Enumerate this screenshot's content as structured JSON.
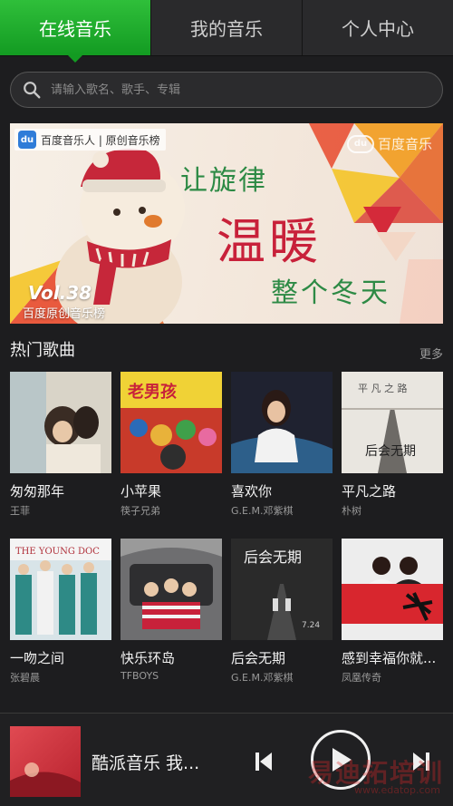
{
  "tabs": [
    {
      "label": "在线音乐",
      "active": true
    },
    {
      "label": "我的音乐",
      "active": false
    },
    {
      "label": "个人中心",
      "active": false
    }
  ],
  "search": {
    "placeholder": "请输入歌名、歌手、专辑",
    "icon": "search-icon"
  },
  "banner": {
    "brand_icon_text": "du",
    "brand_text": "百度音乐人 | 原创音乐榜",
    "logo_text": "百度音乐",
    "logo_badge": "du",
    "line1": "让旋律",
    "line2": "温暖",
    "line3": "整个冬天",
    "vol": "Vol.38",
    "vol_sub": "百度原创音乐榜"
  },
  "hot_songs": {
    "title": "热门歌曲",
    "more": "更多",
    "items": [
      {
        "title": "匆匆那年",
        "artist": "王菲"
      },
      {
        "title": "小苹果",
        "artist": "筷子兄弟"
      },
      {
        "title": "喜欢你",
        "artist": "G.E.M.邓紫棋"
      },
      {
        "title": "平凡之路",
        "artist": "朴树"
      },
      {
        "title": "一吻之间",
        "artist": "张碧晨"
      },
      {
        "title": "快乐环岛",
        "artist": "TFBOYS"
      },
      {
        "title": "后会无期",
        "artist": "G.E.M.邓紫棋"
      },
      {
        "title": "感到幸福你就...",
        "artist": "凤凰传奇"
      }
    ]
  },
  "player": {
    "now_playing": "酷派音乐 我...",
    "watermark": "易迪拓培训",
    "watermark_sub": "www.edatop.com"
  }
}
